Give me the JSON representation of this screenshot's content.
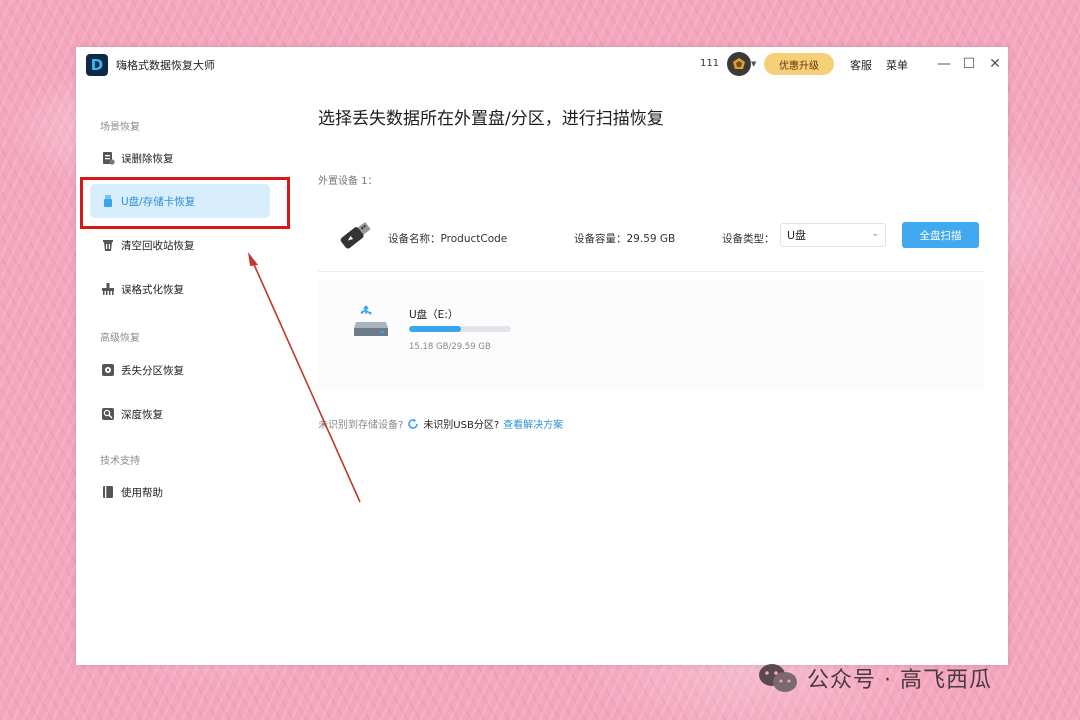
{
  "app": {
    "title": "嗨格式数据恢复大师",
    "logo_letter": "D",
    "user_id": "111",
    "upgrade_label": "优惠升级",
    "service_label": "客服",
    "menu_label": "菜单",
    "window_controls": {
      "minimize": "—",
      "maximize": "☐",
      "close": "✕"
    }
  },
  "sidebar": {
    "sections": [
      {
        "label": "场景恢复"
      },
      {
        "label": "高级恢复"
      },
      {
        "label": "技术支持"
      }
    ],
    "items": [
      {
        "label": "误删除恢复",
        "icon": "file-delete-icon",
        "active": false
      },
      {
        "label": "U盘/存储卡恢复",
        "icon": "usb-drive-icon",
        "active": true
      },
      {
        "label": "清空回收站恢复",
        "icon": "recycle-bin-icon",
        "active": false
      },
      {
        "label": "误格式化恢复",
        "icon": "format-icon",
        "active": false
      },
      {
        "label": "丢失分区恢复",
        "icon": "partition-icon",
        "active": false
      },
      {
        "label": "深度恢复",
        "icon": "deep-scan-icon",
        "active": false
      },
      {
        "label": "使用帮助",
        "icon": "help-book-icon",
        "active": false
      }
    ]
  },
  "main": {
    "title": "选择丢失数据所在外置盘/分区，进行扫描恢复",
    "external_label": "外置设备 1：",
    "device": {
      "name_label": "设备名称：",
      "name": "ProductCode",
      "capacity_label": "设备容量：",
      "capacity": "29.59 GB",
      "type_label": "设备类型：",
      "type_value": "U盘",
      "scan_button": "全盘扫描"
    },
    "partition": {
      "name": "U盘（E:）",
      "used_fraction": 0.513,
      "size_text": "15.18 GB/29.59 GB"
    },
    "help": {
      "question": "未识别到存储设备?",
      "strong": "未识别USB分区?",
      "link": "查看解决方案"
    }
  },
  "watermark": {
    "text": "公众号 · 高飞西瓜"
  },
  "colors": {
    "accent": "#41a9ef",
    "active_bg": "#d9eefc",
    "highlight_box": "#d81818",
    "upgrade_bg": "#f7cf78",
    "background": "#f3a6be"
  }
}
